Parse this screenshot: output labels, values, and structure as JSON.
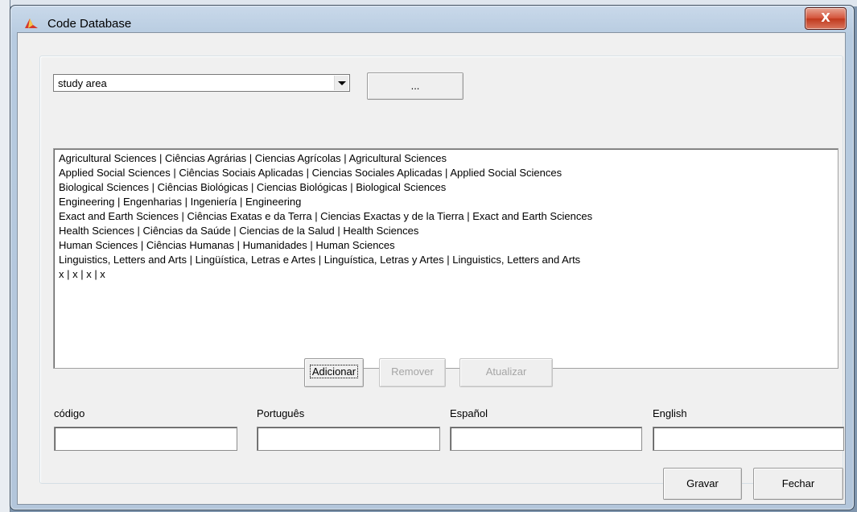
{
  "window": {
    "title": "Code Database",
    "close_glyph": "X"
  },
  "combo": {
    "selected": "study area"
  },
  "more_button": {
    "label": "..."
  },
  "list": {
    "items": [
      "Agricultural Sciences | Ciências Agrárias | Ciencias Agrícolas | Agricultural Sciences",
      "Applied Social Sciences | Ciências Sociais Aplicadas | Ciencias Sociales Aplicadas | Applied Social Sciences",
      "Biological Sciences | Ciências Biológicas | Ciencias Biológicas | Biological Sciences",
      "Engineering | Engenharias | Ingeniería | Engineering",
      "Exact and Earth Sciences | Ciências Exatas e da Terra | Ciencias Exactas y de la Tierra | Exact and Earth Sciences",
      "Health Sciences | Ciências da Saúde | Ciencias de la Salud | Health Sciences",
      "Human Sciences | Ciências Humanas | Humanidades | Human Sciences",
      "Linguistics, Letters and Arts | Lingüística, Letras e Artes | Linguística, Letras y Artes | Linguistics, Letters and Arts",
      "x | x | x | x"
    ]
  },
  "actions": {
    "add": "Adicionar",
    "remove": "Remover",
    "update": "Atualizar"
  },
  "fields": {
    "code_label": "código",
    "pt_label": "Português",
    "es_label": "Español",
    "en_label": "English",
    "code_value": "",
    "pt_value": "",
    "es_value": "",
    "en_value": ""
  },
  "footer": {
    "save": "Gravar",
    "close": "Fechar"
  },
  "colors": {
    "titlebar": "#b7cbe0",
    "close_button": "#c0391d",
    "dialog_bg": "#f0f0f0"
  }
}
